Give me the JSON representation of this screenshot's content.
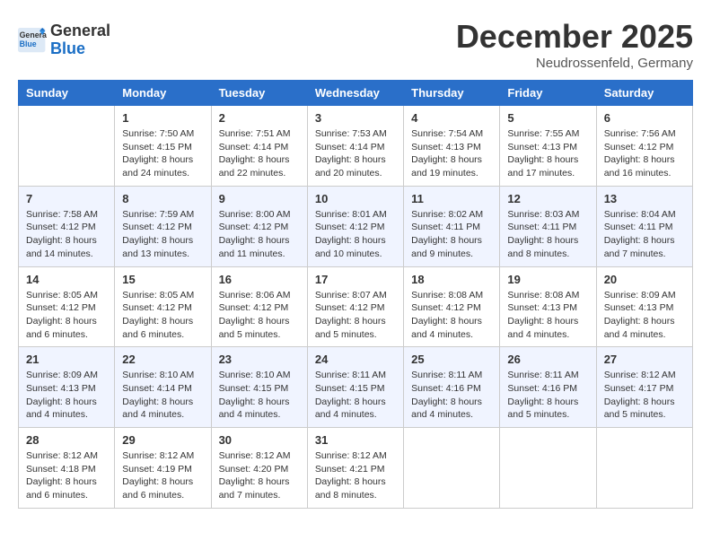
{
  "header": {
    "title": "December 2025",
    "subtitle": "Neudrossenfeld, Germany",
    "logo_general": "General",
    "logo_blue": "Blue"
  },
  "weekdays": [
    "Sunday",
    "Monday",
    "Tuesday",
    "Wednesday",
    "Thursday",
    "Friday",
    "Saturday"
  ],
  "weeks": [
    [
      {
        "day": "",
        "sunrise": "",
        "sunset": "",
        "daylight": ""
      },
      {
        "day": "1",
        "sunrise": "Sunrise: 7:50 AM",
        "sunset": "Sunset: 4:15 PM",
        "daylight": "Daylight: 8 hours and 24 minutes."
      },
      {
        "day": "2",
        "sunrise": "Sunrise: 7:51 AM",
        "sunset": "Sunset: 4:14 PM",
        "daylight": "Daylight: 8 hours and 22 minutes."
      },
      {
        "day": "3",
        "sunrise": "Sunrise: 7:53 AM",
        "sunset": "Sunset: 4:14 PM",
        "daylight": "Daylight: 8 hours and 20 minutes."
      },
      {
        "day": "4",
        "sunrise": "Sunrise: 7:54 AM",
        "sunset": "Sunset: 4:13 PM",
        "daylight": "Daylight: 8 hours and 19 minutes."
      },
      {
        "day": "5",
        "sunrise": "Sunrise: 7:55 AM",
        "sunset": "Sunset: 4:13 PM",
        "daylight": "Daylight: 8 hours and 17 minutes."
      },
      {
        "day": "6",
        "sunrise": "Sunrise: 7:56 AM",
        "sunset": "Sunset: 4:12 PM",
        "daylight": "Daylight: 8 hours and 16 minutes."
      }
    ],
    [
      {
        "day": "7",
        "sunrise": "Sunrise: 7:58 AM",
        "sunset": "Sunset: 4:12 PM",
        "daylight": "Daylight: 8 hours and 14 minutes."
      },
      {
        "day": "8",
        "sunrise": "Sunrise: 7:59 AM",
        "sunset": "Sunset: 4:12 PM",
        "daylight": "Daylight: 8 hours and 13 minutes."
      },
      {
        "day": "9",
        "sunrise": "Sunrise: 8:00 AM",
        "sunset": "Sunset: 4:12 PM",
        "daylight": "Daylight: 8 hours and 11 minutes."
      },
      {
        "day": "10",
        "sunrise": "Sunrise: 8:01 AM",
        "sunset": "Sunset: 4:12 PM",
        "daylight": "Daylight: 8 hours and 10 minutes."
      },
      {
        "day": "11",
        "sunrise": "Sunrise: 8:02 AM",
        "sunset": "Sunset: 4:11 PM",
        "daylight": "Daylight: 8 hours and 9 minutes."
      },
      {
        "day": "12",
        "sunrise": "Sunrise: 8:03 AM",
        "sunset": "Sunset: 4:11 PM",
        "daylight": "Daylight: 8 hours and 8 minutes."
      },
      {
        "day": "13",
        "sunrise": "Sunrise: 8:04 AM",
        "sunset": "Sunset: 4:11 PM",
        "daylight": "Daylight: 8 hours and 7 minutes."
      }
    ],
    [
      {
        "day": "14",
        "sunrise": "Sunrise: 8:05 AM",
        "sunset": "Sunset: 4:12 PM",
        "daylight": "Daylight: 8 hours and 6 minutes."
      },
      {
        "day": "15",
        "sunrise": "Sunrise: 8:05 AM",
        "sunset": "Sunset: 4:12 PM",
        "daylight": "Daylight: 8 hours and 6 minutes."
      },
      {
        "day": "16",
        "sunrise": "Sunrise: 8:06 AM",
        "sunset": "Sunset: 4:12 PM",
        "daylight": "Daylight: 8 hours and 5 minutes."
      },
      {
        "day": "17",
        "sunrise": "Sunrise: 8:07 AM",
        "sunset": "Sunset: 4:12 PM",
        "daylight": "Daylight: 8 hours and 5 minutes."
      },
      {
        "day": "18",
        "sunrise": "Sunrise: 8:08 AM",
        "sunset": "Sunset: 4:12 PM",
        "daylight": "Daylight: 8 hours and 4 minutes."
      },
      {
        "day": "19",
        "sunrise": "Sunrise: 8:08 AM",
        "sunset": "Sunset: 4:13 PM",
        "daylight": "Daylight: 8 hours and 4 minutes."
      },
      {
        "day": "20",
        "sunrise": "Sunrise: 8:09 AM",
        "sunset": "Sunset: 4:13 PM",
        "daylight": "Daylight: 8 hours and 4 minutes."
      }
    ],
    [
      {
        "day": "21",
        "sunrise": "Sunrise: 8:09 AM",
        "sunset": "Sunset: 4:13 PM",
        "daylight": "Daylight: 8 hours and 4 minutes."
      },
      {
        "day": "22",
        "sunrise": "Sunrise: 8:10 AM",
        "sunset": "Sunset: 4:14 PM",
        "daylight": "Daylight: 8 hours and 4 minutes."
      },
      {
        "day": "23",
        "sunrise": "Sunrise: 8:10 AM",
        "sunset": "Sunset: 4:15 PM",
        "daylight": "Daylight: 8 hours and 4 minutes."
      },
      {
        "day": "24",
        "sunrise": "Sunrise: 8:11 AM",
        "sunset": "Sunset: 4:15 PM",
        "daylight": "Daylight: 8 hours and 4 minutes."
      },
      {
        "day": "25",
        "sunrise": "Sunrise: 8:11 AM",
        "sunset": "Sunset: 4:16 PM",
        "daylight": "Daylight: 8 hours and 4 minutes."
      },
      {
        "day": "26",
        "sunrise": "Sunrise: 8:11 AM",
        "sunset": "Sunset: 4:16 PM",
        "daylight": "Daylight: 8 hours and 5 minutes."
      },
      {
        "day": "27",
        "sunrise": "Sunrise: 8:12 AM",
        "sunset": "Sunset: 4:17 PM",
        "daylight": "Daylight: 8 hours and 5 minutes."
      }
    ],
    [
      {
        "day": "28",
        "sunrise": "Sunrise: 8:12 AM",
        "sunset": "Sunset: 4:18 PM",
        "daylight": "Daylight: 8 hours and 6 minutes."
      },
      {
        "day": "29",
        "sunrise": "Sunrise: 8:12 AM",
        "sunset": "Sunset: 4:19 PM",
        "daylight": "Daylight: 8 hours and 6 minutes."
      },
      {
        "day": "30",
        "sunrise": "Sunrise: 8:12 AM",
        "sunset": "Sunset: 4:20 PM",
        "daylight": "Daylight: 8 hours and 7 minutes."
      },
      {
        "day": "31",
        "sunrise": "Sunrise: 8:12 AM",
        "sunset": "Sunset: 4:21 PM",
        "daylight": "Daylight: 8 hours and 8 minutes."
      },
      {
        "day": "",
        "sunrise": "",
        "sunset": "",
        "daylight": ""
      },
      {
        "day": "",
        "sunrise": "",
        "sunset": "",
        "daylight": ""
      },
      {
        "day": "",
        "sunrise": "",
        "sunset": "",
        "daylight": ""
      }
    ]
  ]
}
